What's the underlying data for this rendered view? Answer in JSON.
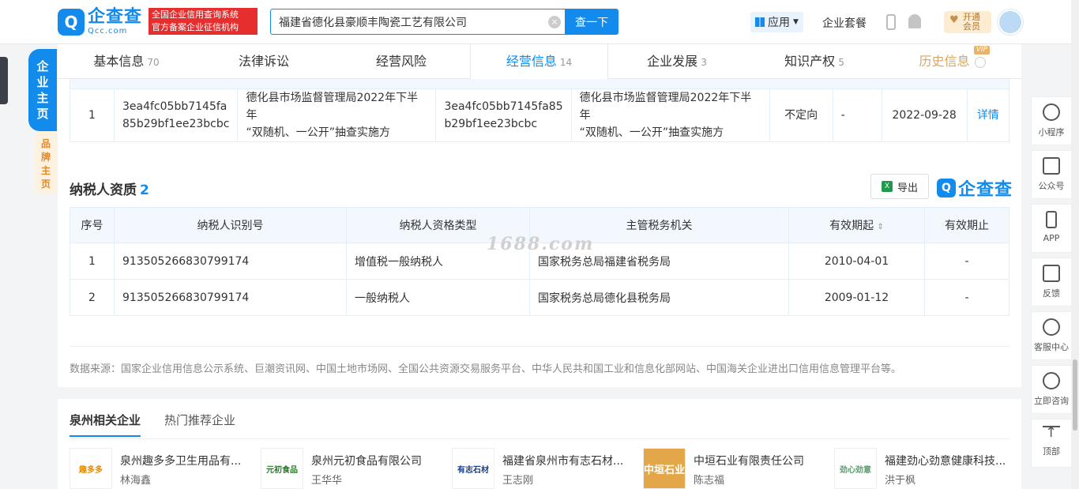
{
  "header": {
    "logo_cn": "企查查",
    "logo_en": "Qcc.com",
    "tag_line1": "全国企业信用查询系统",
    "tag_line2": "官方备案企业征信机构",
    "search_value": "福建省德化县豪顺丰陶瓷工艺有限公司",
    "search_button": "查一下",
    "apps_label": "应用",
    "suite_label": "企业套餐",
    "vip_line1": "开通",
    "vip_line2": "会员"
  },
  "sidebar": {
    "main_tab": [
      "企",
      "业",
      "主",
      "页"
    ],
    "brand_tab": [
      "品",
      "牌",
      "主",
      "页"
    ]
  },
  "tabs": [
    {
      "label": "基本信息",
      "count": "70"
    },
    {
      "label": "法律诉讼",
      "count": ""
    },
    {
      "label": "经营风险",
      "count": ""
    },
    {
      "label": "经营信息",
      "count": "14"
    },
    {
      "label": "企业发展",
      "count": "3"
    },
    {
      "label": "知识产权",
      "count": "5"
    },
    {
      "label": "历史信息",
      "count": "",
      "badge": "VIP"
    }
  ],
  "inspection": {
    "row": {
      "index": "1",
      "id_a_line1": "3ea4fc05bb7145fa",
      "id_a_line2": "85b29bf1ee23bcbc",
      "plan_a_line1": "德化县市场监督管理局2022年下半年",
      "plan_a_line2": "“双随机、一公开”抽查实施方",
      "id_b_line1": "3ea4fc05bb7145fa85",
      "id_b_line2": "b29bf1ee23bcbc",
      "plan_b_line1": "德化县市场监督管理局2022年下半年",
      "plan_b_line2": "“双随机、一公开”抽查实施方",
      "type": "不定向",
      "dash": "-",
      "date": "2022-09-28",
      "detail": "详情"
    }
  },
  "taxpayer": {
    "title": "纳税人资质",
    "count": "2",
    "export_label": "导出",
    "brand": "企查查",
    "columns": [
      "序号",
      "纳税人识别号",
      "纳税人资格类型",
      "主管税务机关",
      "有效期起",
      "有效期止"
    ],
    "sort_mark": "⇕",
    "rows": [
      {
        "index": "1",
        "tax_id": "913505266830799174",
        "type": "增值税一般纳税人",
        "authority": "国家税务总局福建省税务局",
        "start": "2010-04-01",
        "end": "-"
      },
      {
        "index": "2",
        "tax_id": "913505266830799174",
        "type": "一般纳税人",
        "authority": "国家税务总局德化县税务局",
        "start": "2009-01-12",
        "end": "-"
      }
    ],
    "watermark": "1688.com"
  },
  "source_note": "数据来源：国家企业信用信息公示系统、巨潮资讯网、中国土地市场网、全国公共资源交易服务平台、中华人民共和国工业和信息化部网站、中国海关企业进出口信用信息管理平台等。",
  "related": {
    "tab_active": "泉州相关企业",
    "tab_other": "热门推荐企业",
    "cards": [
      {
        "name": "泉州趣多多卫生用品有...",
        "person": "林海鑫",
        "thumb": "趣多多",
        "color": "#e68a00"
      },
      {
        "name": "泉州元初食品有限公司",
        "person": "王华华",
        "thumb": "元初食品",
        "color": "#2a7a2a"
      },
      {
        "name": "福建省泉州市有志石材...",
        "person": "王志刚",
        "thumb": "有志石材",
        "color": "#1a3f8a"
      },
      {
        "name": "中垣石业有限责任公司",
        "person": "陈志福",
        "thumb": "中垣石业",
        "color": "#ffffff"
      },
      {
        "name": "福建劲心劲意健康科技...",
        "person": "洪于枫",
        "thumb": "劲心劲意",
        "color": "#5a9a6a"
      }
    ]
  },
  "right_tools": [
    "小程序",
    "公众号",
    "APP",
    "反馈",
    "客服中心",
    "立即咨询",
    "顶部"
  ],
  "colors": {
    "accent": "#128bed",
    "vip": "#d9a562",
    "red": "#e62e2e"
  }
}
